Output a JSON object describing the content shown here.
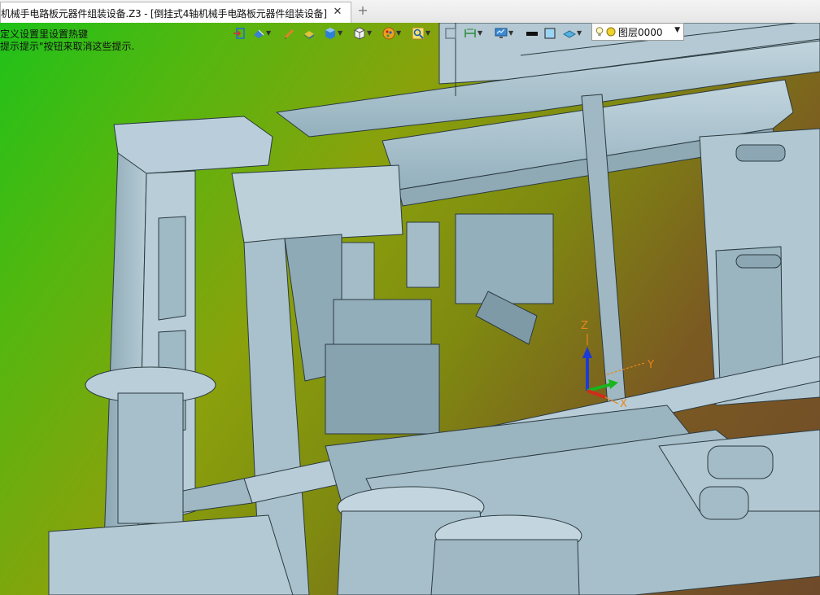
{
  "tab": {
    "title": "机械手电路板元器件组装设备.Z3 - [倒挂式4轴机械手电路板元器件组装设备]",
    "close_symbol": "✕",
    "new_tab_symbol": "+"
  },
  "hints": {
    "line1": "定义设置里设置热键",
    "line2": "提示提示\"按钮来取消这些提示."
  },
  "toolbar": {
    "icons": [
      "view-align-icon",
      "render-mode-icon",
      "sketch-icon",
      "box-display-icon",
      "solid-cube-icon",
      "wire-cube-icon",
      "appearance-icon",
      "zoom-icon",
      "frame-icon",
      "dimension-icon",
      "display-settings-icon",
      "color-icon",
      "plane-icon"
    ],
    "layer_name": "图层0000"
  },
  "triad": {
    "z": "Z",
    "y": "Y",
    "x": "X"
  },
  "colors": {
    "gradient_start": "#1fc21a",
    "gradient_end": "#6e4a2a",
    "model": "#a9c3d0",
    "axis_label": "#e8861a"
  }
}
